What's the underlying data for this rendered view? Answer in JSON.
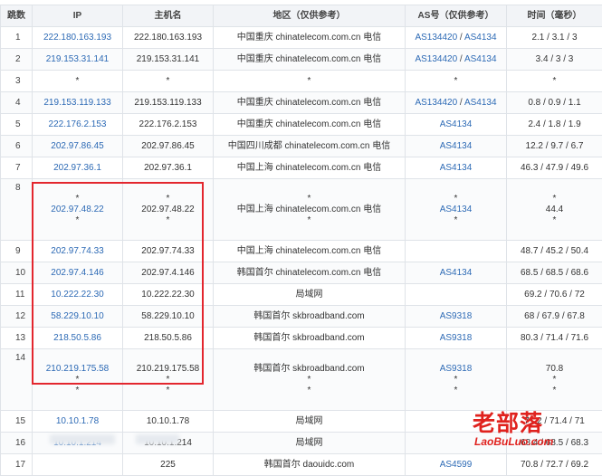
{
  "headers": [
    "跳数",
    "IP",
    "主机名",
    "地区（仅供参考）",
    "AS号（仅供参考）",
    "时间（毫秒）"
  ],
  "rows": [
    {
      "hop": "1",
      "ip": [
        "222.180.163.193"
      ],
      "host": [
        "222.180.163.193"
      ],
      "region": [
        "中国重庆 chinatelecom.com.cn 电信"
      ],
      "asn": [
        [
          "AS134420",
          "AS4134"
        ]
      ],
      "time": [
        "2.1 / 3.1 / 3"
      ]
    },
    {
      "hop": "2",
      "ip": [
        "219.153.31.141"
      ],
      "host": [
        "219.153.31.141"
      ],
      "region": [
        "中国重庆 chinatelecom.com.cn 电信"
      ],
      "asn": [
        [
          "AS134420",
          "AS4134"
        ]
      ],
      "time": [
        "3.4 / 3 / 3"
      ]
    },
    {
      "hop": "3",
      "ip": [
        "*"
      ],
      "host": [
        "*"
      ],
      "region": [
        "*"
      ],
      "asn": [
        [
          "*"
        ]
      ],
      "time": [
        "*"
      ]
    },
    {
      "hop": "4",
      "ip": [
        "219.153.119.133"
      ],
      "host": [
        "219.153.119.133"
      ],
      "region": [
        "中国重庆 chinatelecom.com.cn 电信"
      ],
      "asn": [
        [
          "AS134420",
          "AS4134"
        ]
      ],
      "time": [
        "0.8 / 0.9 / 1.1"
      ]
    },
    {
      "hop": "5",
      "ip": [
        "222.176.2.153"
      ],
      "host": [
        "222.176.2.153"
      ],
      "region": [
        "中国重庆 chinatelecom.com.cn 电信"
      ],
      "asn": [
        [
          "AS4134"
        ]
      ],
      "time": [
        "2.4 / 1.8 / 1.9"
      ]
    },
    {
      "hop": "6",
      "ip": [
        "202.97.86.45"
      ],
      "host": [
        "202.97.86.45"
      ],
      "region": [
        "中国四川成都 chinatelecom.com.cn 电信"
      ],
      "asn": [
        [
          "AS4134"
        ]
      ],
      "time": [
        "12.2 / 9.7 / 6.7"
      ]
    },
    {
      "hop": "7",
      "ip": [
        "202.97.36.1"
      ],
      "host": [
        "202.97.36.1"
      ],
      "region": [
        "中国上海 chinatelecom.com.cn 电信"
      ],
      "asn": [
        [
          "AS4134"
        ]
      ],
      "time": [
        "46.3 / 47.9 / 49.6"
      ]
    },
    {
      "hop": "8",
      "ip": [
        "*",
        "202.97.48.22",
        "*"
      ],
      "host": [
        "*",
        "202.97.48.22",
        "*"
      ],
      "region": [
        "*",
        "中国上海 chinatelecom.com.cn 电信",
        "*"
      ],
      "asn": [
        [
          "*"
        ],
        [
          "AS4134"
        ],
        [
          "*"
        ]
      ],
      "time": [
        "*",
        "44.4",
        "*"
      ]
    },
    {
      "hop": "9",
      "ip": [
        "202.97.74.33"
      ],
      "host": [
        "202.97.74.33"
      ],
      "region": [
        "中国上海 chinatelecom.com.cn 电信"
      ],
      "asn": [
        [
          ""
        ]
      ],
      "time": [
        "48.7 / 45.2 / 50.4"
      ]
    },
    {
      "hop": "10",
      "ip": [
        "202.97.4.146"
      ],
      "host": [
        "202.97.4.146"
      ],
      "region": [
        "韩国首尔 chinatelecom.com.cn 电信"
      ],
      "asn": [
        [
          "AS4134"
        ]
      ],
      "time": [
        "68.5 / 68.5 / 68.6"
      ]
    },
    {
      "hop": "11",
      "ip": [
        "10.222.22.30"
      ],
      "host": [
        "10.222.22.30"
      ],
      "region": [
        "局域网"
      ],
      "asn": [
        [
          ""
        ]
      ],
      "time": [
        "69.2 / 70.6 / 72"
      ]
    },
    {
      "hop": "12",
      "ip": [
        "58.229.10.10"
      ],
      "host": [
        "58.229.10.10"
      ],
      "region": [
        "韩国首尔 skbroadband.com"
      ],
      "asn": [
        [
          "AS9318"
        ]
      ],
      "time": [
        "68 / 67.9 / 67.8"
      ]
    },
    {
      "hop": "13",
      "ip": [
        "218.50.5.86"
      ],
      "host": [
        "218.50.5.86"
      ],
      "region": [
        "韩国首尔 skbroadband.com"
      ],
      "asn": [
        [
          "AS9318"
        ]
      ],
      "time": [
        "80.3 / 71.4 / 71.6"
      ]
    },
    {
      "hop": "14",
      "ip": [
        "210.219.175.58",
        "*",
        "*"
      ],
      "host": [
        "210.219.175.58",
        "*",
        "*"
      ],
      "region": [
        "韩国首尔 skbroadband.com",
        "*",
        "*"
      ],
      "asn": [
        [
          "AS9318"
        ],
        [
          "*"
        ],
        [
          "*"
        ]
      ],
      "time": [
        "70.8",
        "*",
        "*"
      ]
    },
    {
      "hop": "15",
      "ip": [
        "10.10.1.78"
      ],
      "host": [
        "10.10.1.78"
      ],
      "region": [
        "局域网"
      ],
      "asn": [
        [
          ""
        ]
      ],
      "time": [
        "71.2 / 71.4 / 71"
      ]
    },
    {
      "hop": "16",
      "ip": [
        "10.10.1.214"
      ],
      "host": [
        "10.10.1.214"
      ],
      "region": [
        "局域网"
      ],
      "asn": [
        [
          ""
        ]
      ],
      "time": [
        "68.4 / 68.5 / 68.3"
      ]
    },
    {
      "hop": "17",
      "ip": [
        ""
      ],
      "host": [
        "225"
      ],
      "region": [
        "韩国首尔 daouidc.com"
      ],
      "asn": [
        [
          "AS4599"
        ]
      ],
      "time": [
        "70.8 / 72.7 / 69.2"
      ]
    }
  ],
  "watermark": {
    "cn": "老部落",
    "en": "LaoBuLuo.com"
  },
  "colors": {
    "link": "#2d6ab5",
    "highlight": "#e3262e",
    "header_bg": "#f2f4f7",
    "border": "#dfe3e8"
  }
}
